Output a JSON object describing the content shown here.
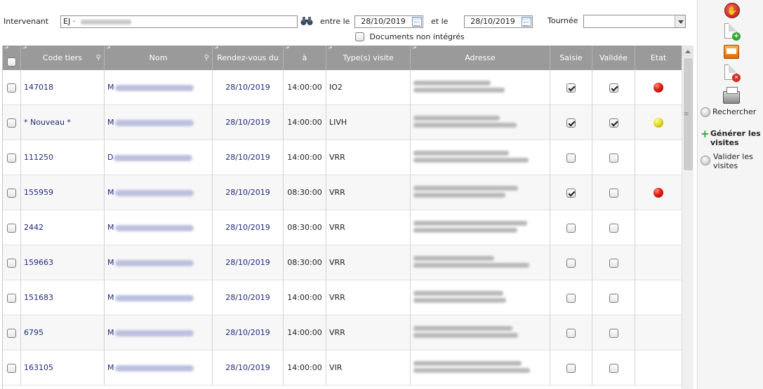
{
  "filters": {
    "intervenant_label": "Intervenant",
    "intervenant_value": "EJ ·",
    "entre_le_label": "entre le",
    "date_from": "28/10/2019",
    "et_le_label": "et le",
    "date_to": "28/10/2019",
    "tournee_label": "Tournée",
    "tournee_value": "",
    "docs_label": "Documents non intégrés"
  },
  "table": {
    "headers": [
      "Code tiers",
      "Nom",
      "Rendez-vous du",
      "à",
      "Type(s) visite",
      "Adresse",
      "Saisie",
      "Validée",
      "Etat"
    ],
    "rows": [
      {
        "code": "147018",
        "nom": "M",
        "rdv": "28/10/2019",
        "heure": "14:00:00",
        "type": "IO2",
        "saisie": true,
        "validee": true,
        "etat": "red"
      },
      {
        "code": "* Nouveau *",
        "nom": "M",
        "rdv": "28/10/2019",
        "heure": "14:00:00",
        "type": "LIVH",
        "saisie": true,
        "validee": true,
        "etat": "yellow"
      },
      {
        "code": "111250",
        "nom": "D",
        "rdv": "28/10/2019",
        "heure": "14:00:00",
        "type": "VRR",
        "saisie": false,
        "validee": false,
        "etat": ""
      },
      {
        "code": "155959",
        "nom": "M",
        "rdv": "28/10/2019",
        "heure": "08:30:00",
        "type": "VRR",
        "saisie": true,
        "validee": false,
        "etat": "red"
      },
      {
        "code": "2442",
        "nom": "M",
        "rdv": "28/10/2019",
        "heure": "08:30:00",
        "type": "VRR",
        "saisie": false,
        "validee": false,
        "etat": ""
      },
      {
        "code": "159663",
        "nom": "M",
        "rdv": "28/10/2019",
        "heure": "08:30:00",
        "type": "VRR",
        "saisie": false,
        "validee": false,
        "etat": ""
      },
      {
        "code": "151683",
        "nom": "M",
        "rdv": "28/10/2019",
        "heure": "14:00:00",
        "type": "VRR",
        "saisie": false,
        "validee": false,
        "etat": ""
      },
      {
        "code": "6795",
        "nom": "M",
        "rdv": "28/10/2019",
        "heure": "14:00:00",
        "type": "VRR",
        "saisie": false,
        "validee": false,
        "etat": ""
      },
      {
        "code": "163105",
        "nom": "M",
        "rdv": "28/10/2019",
        "heure": "14:00:00",
        "type": "VIR",
        "saisie": false,
        "validee": false,
        "etat": ""
      }
    ]
  },
  "panel": {
    "rechercher": "Rechercher",
    "generer_line1": "Générer les",
    "generer_line2": "visites",
    "valider_line1": "Valider les",
    "valider_line2": "visites"
  },
  "colors": {
    "header_bg": "#9a9a9a",
    "link_text": "#1f2a7a",
    "status_red": "#e21a10",
    "status_yellow": "#e6df22"
  }
}
